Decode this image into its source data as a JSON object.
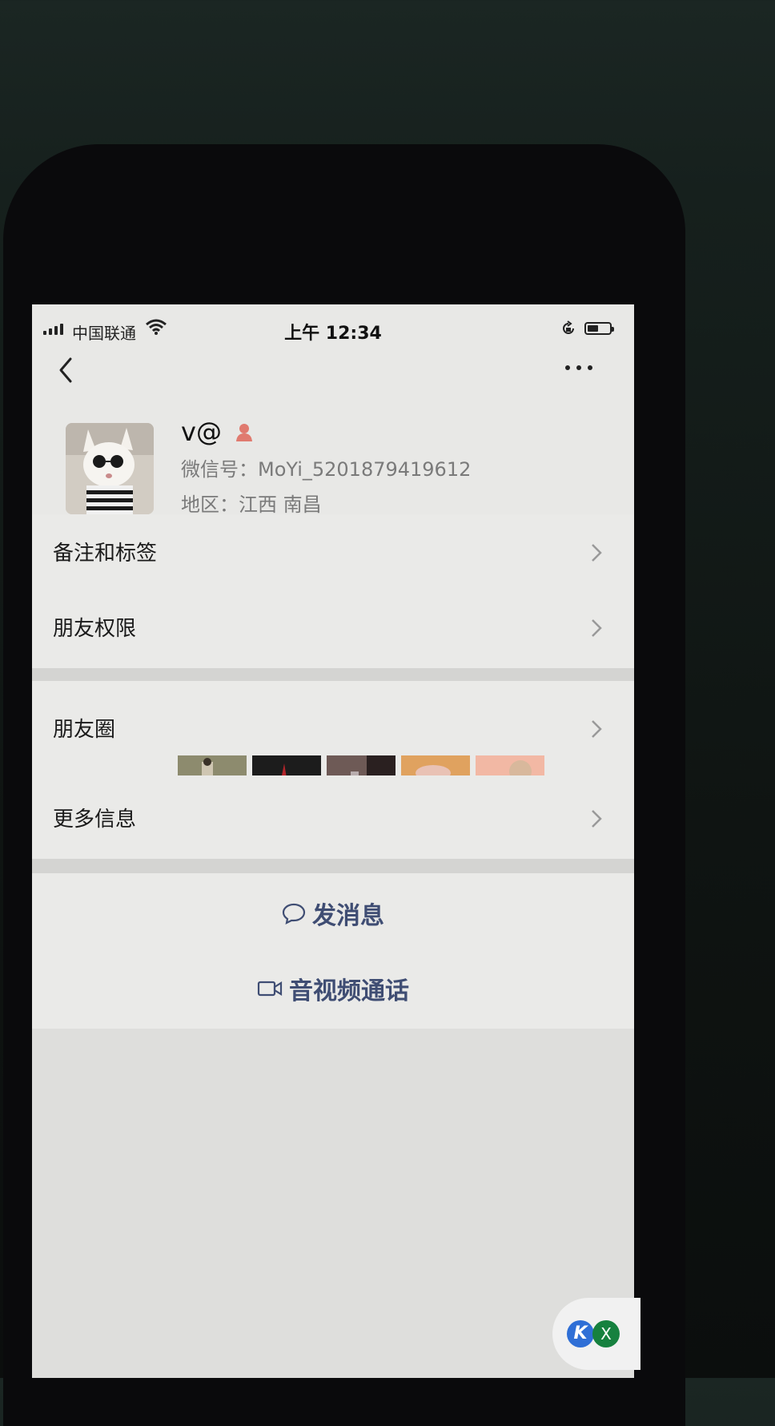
{
  "status_bar": {
    "carrier": "中国联通",
    "time": "上午 12:34",
    "battery_level": 0.5
  },
  "profile": {
    "nickname": "v@",
    "gender_icon": "female-icon",
    "wxid": "微信号：MoYi_5201879419612",
    "region": "地区：江西 南昌",
    "avatar_icon": "cat-with-sunglasses-avatar"
  },
  "menu": {
    "remark_tags": "备注和标签",
    "friend_permissions": "朋友权限",
    "moments": "朋友圈",
    "more_info": "更多信息"
  },
  "actions": {
    "send_message": "发消息",
    "video_call": "音视频通话"
  },
  "icons": {
    "back": "chevron-left-icon",
    "more": "ellipsis-icon",
    "chevron": "chevron-right-icon",
    "message": "chat-bubble-icon",
    "video": "video-camera-icon"
  },
  "colors": {
    "page_bg": "#e8e8e6",
    "action_text": "#3f4d73",
    "gender_icon": "#e07a6f"
  }
}
